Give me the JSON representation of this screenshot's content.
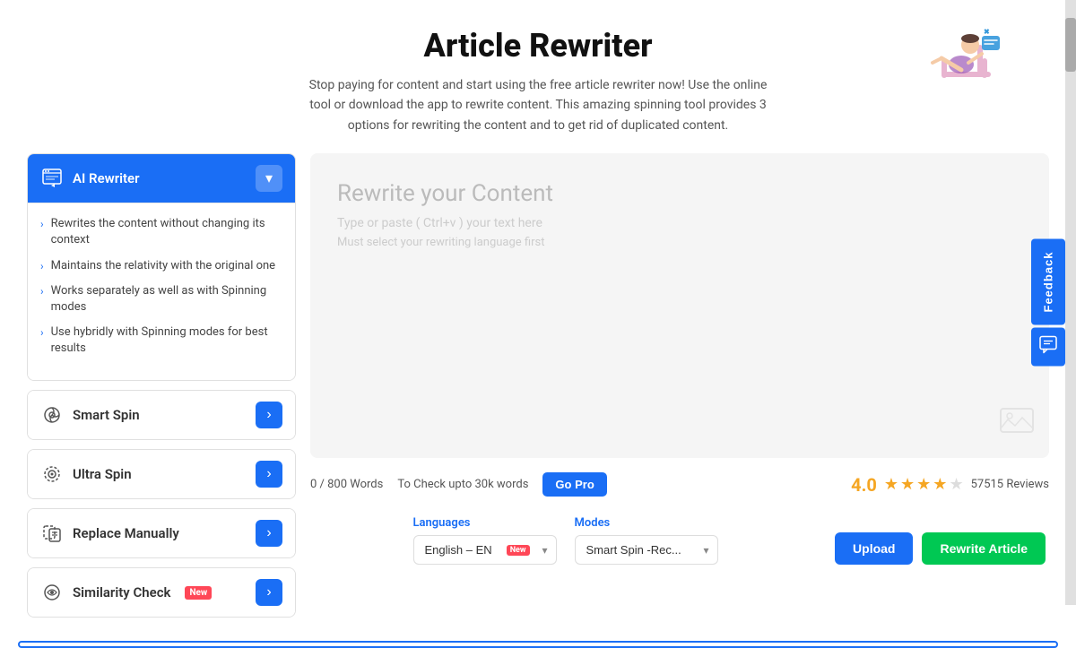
{
  "header": {
    "title": "Article Rewriter",
    "description": "Stop paying for content and start using the free article rewriter now! Use the online tool or download the app to rewrite content. This amazing spinning tool provides 3 options for rewriting the content and to get rid of duplicated content."
  },
  "sidebar": {
    "items": [
      {
        "id": "ai-rewriter",
        "label": "AI Rewriter",
        "active": true,
        "expanded": true,
        "features": [
          "Rewrites the content without changing its context",
          "Maintains the relativity with the original one",
          "Works separately as well as with Spinning modes",
          "Use hybridly with Spinning modes for best results"
        ]
      },
      {
        "id": "smart-spin",
        "label": "Smart Spin",
        "active": false,
        "expanded": false
      },
      {
        "id": "ultra-spin",
        "label": "Ultra Spin",
        "active": false,
        "expanded": false
      },
      {
        "id": "replace-manually",
        "label": "Replace Manually",
        "active": false,
        "expanded": false
      },
      {
        "id": "similarity-check",
        "label": "Similarity Check",
        "active": false,
        "expanded": false,
        "badge": "New"
      }
    ]
  },
  "editor": {
    "placeholder_title": "Rewrite your Content",
    "placeholder_text": "Type or paste ( Ctrl+v ) your text here",
    "placeholder_warning": "Must select your rewriting language first",
    "word_count": "0 / 800 Words",
    "pro_hint": "To Check upto 30k words",
    "go_pro_label": "Go Pro"
  },
  "rating": {
    "score": "4.0",
    "reviews": "57515 Reviews",
    "stars": [
      true,
      true,
      true,
      true,
      false
    ]
  },
  "controls": {
    "languages_label": "Languages",
    "modes_label": "Modes",
    "language_value": "English – EN",
    "language_badge": "New",
    "mode_value": "Smart Spin -Rec...",
    "upload_label": "Upload",
    "rewrite_label": "Rewrite Article"
  },
  "feedback": {
    "label": "Feedback"
  }
}
